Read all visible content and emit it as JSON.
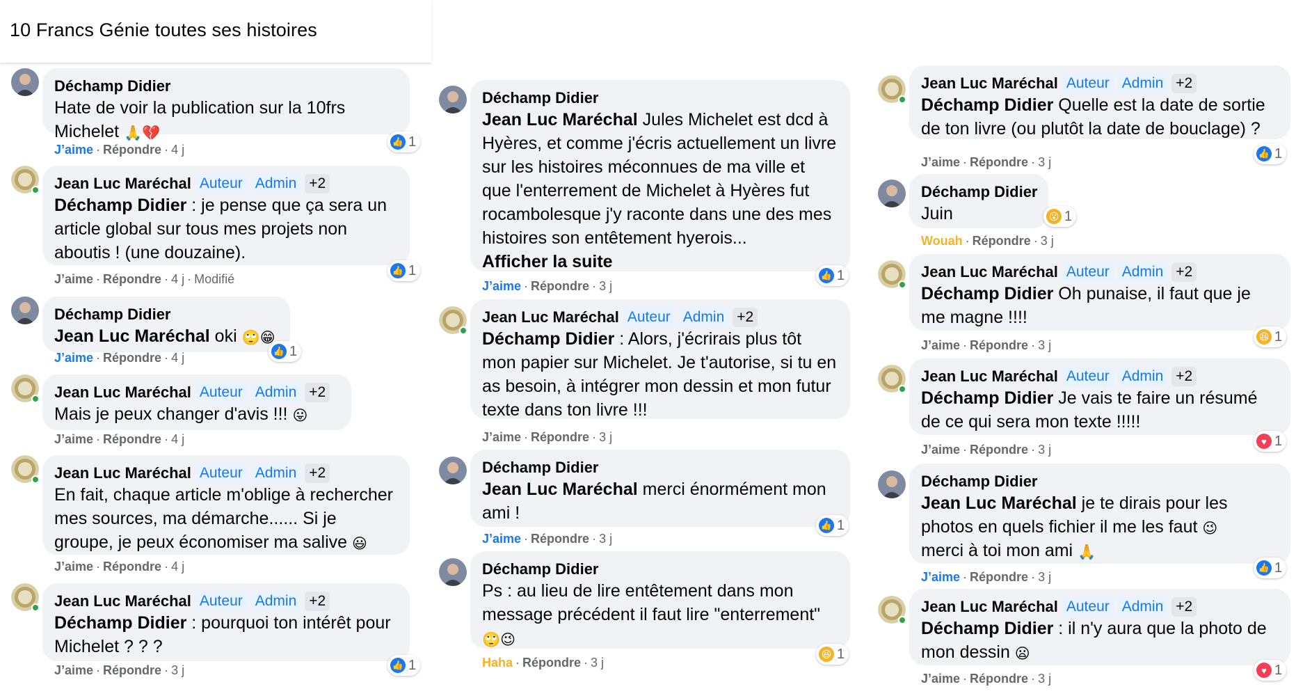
{
  "header": {
    "title": "10 Francs Génie toutes ses histoires"
  },
  "labels": {
    "like": "J’aime",
    "reply": "Répondre",
    "edited": "Modifié",
    "author_badge": "Auteur",
    "admin_badge": "Admin",
    "plus_badge": "+2",
    "see_more": "Afficher la suite",
    "haha": "Haha",
    "wouah": "Wouah"
  },
  "names": {
    "didier": "Déchamp Didier",
    "jlm": "Jean Luc Maréchal"
  },
  "colors": {
    "accent": "#1877f2",
    "bubble": "#f0f2f5",
    "love": "#f33e58",
    "haha": "#f7b125",
    "online": "#31a24c"
  },
  "comments": {
    "c1": {
      "text": "Hate de voir la publication sur la 10frs Michelet",
      "emoji": "🙏💔",
      "reaction_count": "1",
      "time": "4 j"
    },
    "c2": {
      "text": " : je pense que ça sera un article global sur tous mes projets non aboutis ! (une douzaine).",
      "reaction_count": "1",
      "time": "4 j"
    },
    "c3": {
      "text": " oki",
      "emoji": "🙄😁",
      "reaction_count": "1",
      "time": "4 j"
    },
    "c4": {
      "text": "Mais je peux changer d'avis !!! ",
      "emoji": "😛",
      "time": "4 j"
    },
    "c5": {
      "text": "En fait, chaque article m'oblige à rechercher mes sources, ma démarche...... Si je groupe, je peux économiser ma salive ",
      "emoji": "😃",
      "time": "4 j"
    },
    "c6": {
      "text": " : pourquoi ton intérêt pour Michelet ? ? ?",
      "reaction_count": "1",
      "time": "3 j"
    },
    "c7": {
      "text": " Jules Michelet est dcd à Hyères, et comme j'écris actuellement un livre sur les histoires méconnues de ma ville et que l'enterrement de Michelet à Hyères fut rocambolesque j'y raconte dans une des mes histoires son entêtement hyerois...",
      "reaction_count": "1",
      "time": "3 j"
    },
    "c8": {
      "text": " : Alors, j'écrirais plus tôt mon papier sur Michelet. Je t'autorise, si tu en as besoin, à intégrer mon dessin et mon futur texte dans ton livre !!!",
      "time": "3 j"
    },
    "c9": {
      "text": " merci énormément mon ami !",
      "reaction_count": "1",
      "time": "3 j"
    },
    "c10": {
      "text": "Ps : au lieu de lire entêtement dans mon message précédent il faut lire \"enterrement\"",
      "emoji": "🙄😉",
      "reaction_count": "1",
      "time": "3 j"
    },
    "c11": {
      "text": " Quelle est la date de sortie de ton livre (ou plutôt la date de bouclage) ?",
      "reaction_count": "1",
      "time": "3 j"
    },
    "c12": {
      "text": "Juin",
      "reaction_count": "1",
      "time": "3 j"
    },
    "c13": {
      "text": " Oh punaise, il faut que je me magne !!!!",
      "reaction_count": "1",
      "time": "3 j"
    },
    "c14": {
      "text": " Je vais te faire un résumé de ce qui sera mon texte !!!!!",
      "reaction_count": "1",
      "time": "3 j"
    },
    "c15": {
      "text": " je te dirais pour les photos en quels fichier il me les faut ",
      "text2": "merci à toi mon ami ",
      "emoji": "😉",
      "emoji2": "🙏",
      "reaction_count": "1",
      "time": "3 j"
    },
    "c16": {
      "text": " : il n'y aura que la photo de mon dessin ",
      "emoji": "😦",
      "reaction_count": "1",
      "time": "3 j"
    }
  }
}
